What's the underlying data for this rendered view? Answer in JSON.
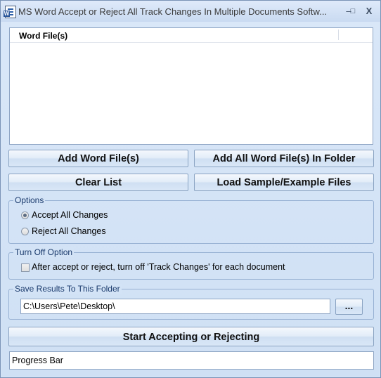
{
  "window": {
    "title": "MS Word Accept or Reject All Track Changes In Multiple Documents Softw...",
    "controls": {
      "minimize": "–",
      "maximize": "□",
      "close": "X"
    }
  },
  "file_list": {
    "column_header": "Word File(s)",
    "items": []
  },
  "buttons": {
    "add_files": "Add Word File(s)",
    "add_folder": "Add All Word File(s) In Folder",
    "clear_list": "Clear List",
    "load_samples": "Load Sample/Example Files",
    "start": "Start Accepting or Rejecting",
    "browse": "..."
  },
  "options": {
    "label": "Options",
    "choices": [
      {
        "label": "Accept All Changes",
        "selected": true
      },
      {
        "label": "Reject All Changes",
        "selected": false
      }
    ]
  },
  "turn_off": {
    "label": "Turn Off Option",
    "checkbox_label": "After accept or reject, turn off 'Track Changes' for each document",
    "checked": false
  },
  "save": {
    "label": "Save Results To This Folder",
    "path": "C:\\Users\\Pete\\Desktop\\"
  },
  "progress": {
    "label": "Progress Bar",
    "value": 0,
    "color": "#6fb34a"
  }
}
